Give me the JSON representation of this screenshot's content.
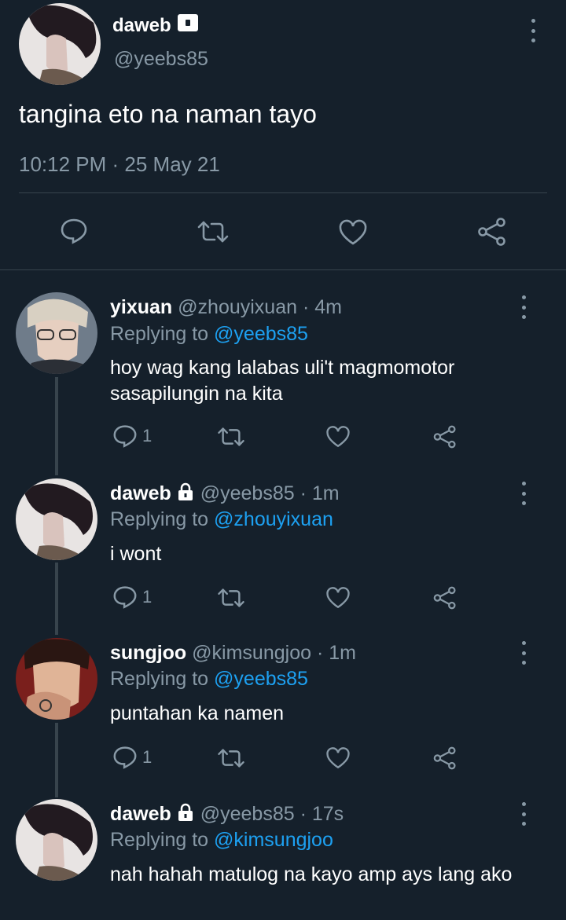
{
  "main_tweet": {
    "name": "daweb",
    "handle": "@yeebs85",
    "text": "tangina eto na naman tayo",
    "timestamp": "10:12 PM · 25 May 21",
    "actions": [
      "reply-icon",
      "retweet-icon",
      "like-icon",
      "share-icon"
    ]
  },
  "replies": [
    {
      "name": "yixuan",
      "meta": "@zhouyixuan · 4m",
      "replying_prefix": "Replying to ",
      "replying_to": "@yeebs85",
      "text": "hoy wag kang lalabas uli't magmomotor sasapilungin na kita",
      "reply_count": "1",
      "locked": false
    },
    {
      "name": "daweb",
      "meta": "@yeebs85 · 1m",
      "replying_prefix": "Replying to ",
      "replying_to": "@zhouyixuan",
      "text": "i wont",
      "reply_count": "1",
      "locked": true
    },
    {
      "name": "sungjoo",
      "meta": "@kimsungjoo · 1m",
      "replying_prefix": "Replying to ",
      "replying_to": "@yeebs85",
      "text": "puntahan ka namen",
      "reply_count": "1",
      "locked": false
    },
    {
      "name": "daweb",
      "meta": "@yeebs85 · 17s",
      "replying_prefix": "Replying to ",
      "replying_to": "@kimsungjoo",
      "text": "nah hahah matulog na kayo amp ays lang ako",
      "locked": true
    }
  ],
  "colors": {
    "background": "#15202b",
    "secondary_text": "#8899a6",
    "accent": "#1da1f2",
    "divider": "#38444d"
  }
}
